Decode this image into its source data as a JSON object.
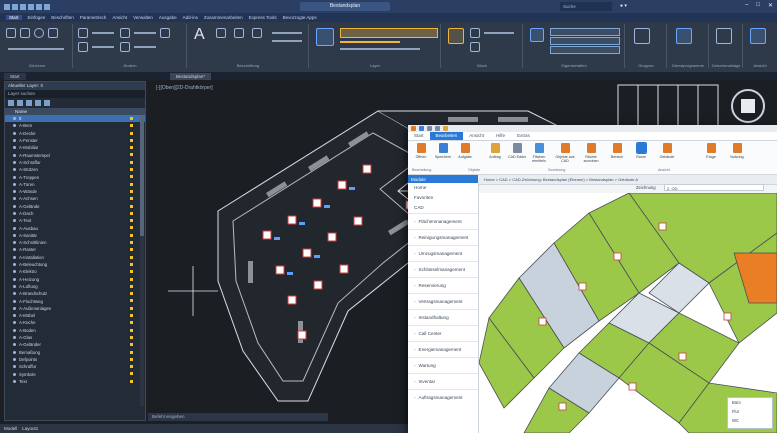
{
  "cad": {
    "title": "Bestandsplan",
    "search_placeholder": "Suche",
    "menu": [
      "Start",
      "Einfügen",
      "Beschriften",
      "Parametrisch",
      "Ansicht",
      "Verwalten",
      "Ausgabe",
      "Add-ins",
      "Zusammenarbeiten",
      "Express Tools",
      "Bevorzugte Apps"
    ],
    "ribbon_groups": [
      "Zeichnen",
      "Ändern",
      "Beschriftung",
      "Layer",
      "Block",
      "Eigenschaften",
      "Gruppen",
      "Dienstprogramme",
      "Zwischenablage",
      "Ansicht"
    ],
    "tabs": [
      "Start",
      "Bestandsplan*"
    ],
    "layer_panel": {
      "title": "Aktueller Layer: 0",
      "filter": "Layer suchen",
      "column_name": "Name",
      "layers": [
        "0",
        "A-Bem",
        "A-Decke",
        "A-Fenster",
        "A-Mobiliar",
        "A-Raumstempel",
        "A-Schraffur",
        "A-Stützen",
        "A-Treppen",
        "A-Türen",
        "A-Wände",
        "A-Achsen",
        "A-Gelände",
        "A-Dach",
        "A-Text",
        "A-Ausbau",
        "A-Sanitär",
        "A-Schnittlinien",
        "A-Raster",
        "A-Installation",
        "A-Beleuchtung",
        "A-Elektro",
        "A-Heizung",
        "A-Lüftung",
        "A-Brandschutz",
        "A-Fluchtweg",
        "A-Außenanlagen",
        "A-Möbel",
        "A-Küche",
        "A-Boden",
        "A-Glas",
        "A-Geländer",
        "Bemaßung",
        "Defpoints",
        "Schraffur",
        "Symbole",
        "Text"
      ],
      "selected_index": 0
    },
    "cmdline_placeholder": "Befehl eingeben",
    "model_tab": "Modell",
    "layout_tab": "Layout1"
  },
  "overlay": {
    "ribbon_tabs": [
      "Start",
      "Bearbeiten",
      "Ansicht",
      "Hilfe",
      "Extras"
    ],
    "active_ribbon_tab": 1,
    "buttons": [
      {
        "label": "Öffnen",
        "color": "#e07b2a"
      },
      {
        "label": "Speichern",
        "color": "#3b7fd4"
      },
      {
        "label": "Aufgabe",
        "color": "#e07b2a"
      },
      {
        "label": "Auftrag",
        "color": "#e0a23a"
      },
      {
        "label": "CAD Editor",
        "color": "#7a8aa0"
      },
      {
        "label": "Flächen ermitteln",
        "color": "#4a90d9"
      },
      {
        "label": "Objekte aus CAD",
        "color": "#e07b2a"
      },
      {
        "label": "Räume zuordnen",
        "color": "#e07b2a"
      },
      {
        "label": "Bereich",
        "color": "#e07b2a"
      },
      {
        "label": "Raum",
        "color": "#2b79d6"
      },
      {
        "label": "Gebäude",
        "color": "#e07b2a"
      },
      {
        "label": "Etage",
        "color": "#e07b2a"
      },
      {
        "label": "Nutzung",
        "color": "#e07b2a"
      }
    ],
    "group_labels": [
      "Bearbeitung",
      "Objekte",
      "Zuordnung",
      "Ansicht"
    ],
    "sidebar_header": "Module",
    "breadcrumb": "Home  >  CAD  >  CAD-Zeichnung: Bestandsplan (Ebenen)  >  Bestandsplan  >  Gebäude A",
    "nav_top": [
      "Home",
      "Favoriten",
      "CAD"
    ],
    "nav_items": [
      "Flächenmanagement",
      "Reinigungsmanagement",
      "Umzugsmanagement",
      "Schlüsselmanagement",
      "Reservierung",
      "Vertragsmanagement",
      "Instandhaltung",
      "Call Center",
      "Energiemanagement",
      "Wartung",
      "Inventar",
      "Auftragsmanagement"
    ],
    "field_label": "Zeichnung",
    "field_value": "2. OG",
    "legend": [
      "Büro",
      "Flur",
      "WC"
    ]
  }
}
